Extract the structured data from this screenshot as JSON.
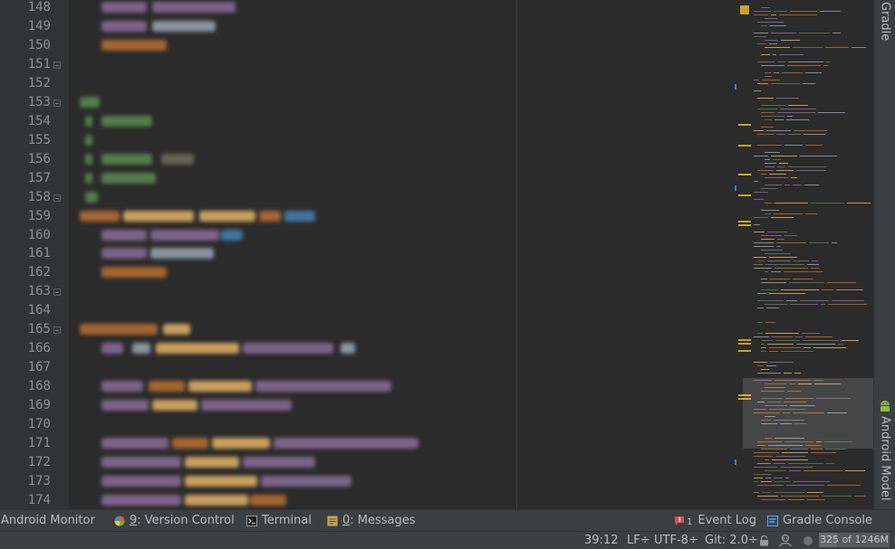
{
  "editor": {
    "line_numbers": [
      "148",
      "149",
      "150",
      "151",
      "152",
      "153",
      "154",
      "155",
      "156",
      "157",
      "158",
      "159",
      "160",
      "161",
      "162",
      "163",
      "164",
      "165",
      "166",
      "167",
      "168",
      "169",
      "170",
      "171",
      "172",
      "173",
      "174"
    ],
    "fold_marker_lines": [
      "151",
      "153",
      "158",
      "163",
      "165"
    ]
  },
  "right_panel": {
    "gradle_label": "Gradle",
    "android_model_label": "Android Model"
  },
  "tool_windows": {
    "android_monitor": "Android Monitor",
    "version_control": {
      "mnemonic": "9",
      "label": ": Version Control"
    },
    "terminal": "Terminal",
    "messages": {
      "mnemonic": "0",
      "label": ": Messages"
    },
    "event_log": "Event Log",
    "event_log_badge": "1",
    "gradle_console": "Gradle Console"
  },
  "status_bar": {
    "caret_position": "39:12",
    "line_separator": "LF÷",
    "encoding": "UTF-8÷",
    "git_branch": "Git: 2.0÷",
    "memory": "325 of 1246M",
    "memory_used_fraction": 0.26
  },
  "colors": {
    "editor_bg": "#2b2b2b",
    "gutter_bg": "#313335",
    "panel_bg": "#3c3f41",
    "keyword": "#cc7832",
    "method": "#ffc66d",
    "field": "#9876aa",
    "string": "#6a8759",
    "number": "#6897bb",
    "comment": "#629755"
  }
}
